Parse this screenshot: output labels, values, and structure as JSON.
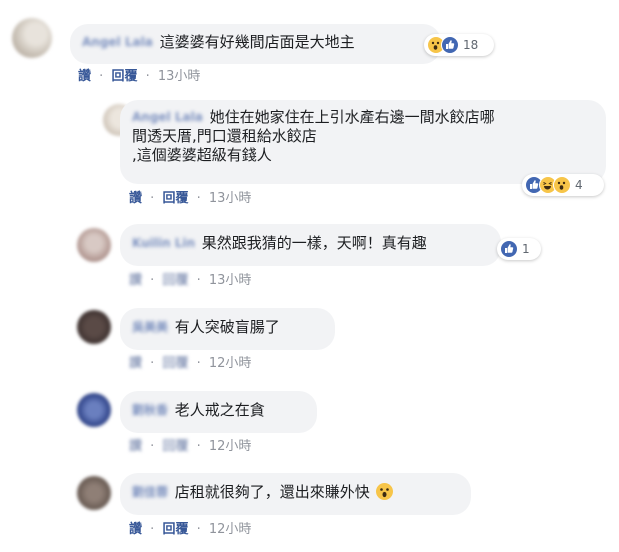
{
  "actions_labels": {
    "like": "讚",
    "reply": "回覆",
    "separator": "·"
  },
  "comments": [
    {
      "author": "Angel Lala",
      "lines": [
        "這婆婆有好幾間店面是大地主"
      ],
      "time": "13小時",
      "reaction_count": "18",
      "reactions": [
        "wow-icon",
        "like-icon"
      ]
    },
    {
      "author": "Angel Lala",
      "lines": [
        "她住在她家住在上引水產右邊一間水餃店哪",
        "間透天厝,門口還租給水餃店",
        ",這個婆婆超級有錢人"
      ],
      "time": "13小時",
      "reaction_count": "4",
      "reactions": [
        "like-icon",
        "haha-icon",
        "wow-icon"
      ]
    },
    {
      "author": "Kuilin Lin",
      "lines": [
        "果然跟我猜的一樣，天啊！真有趣"
      ],
      "time": "13小時",
      "reaction_count": "1",
      "reactions": [
        "like-icon"
      ]
    },
    {
      "author": "吳美美",
      "lines": [
        "有人突破盲腸了"
      ],
      "time": "12小時"
    },
    {
      "author": "劉秋香",
      "lines": [
        "老人戒之在貪"
      ],
      "time": "12小時"
    },
    {
      "author": "劉佳蓉",
      "lines": [
        "店租就很夠了，還出來賺外快"
      ],
      "time": "12小時",
      "inline_emoji": "wow-emoji-icon"
    }
  ],
  "colors": {
    "bubble": "#f2f3f5",
    "link": "#385898",
    "meta": "#90949c",
    "like_blue": "#4267b2",
    "reaction_yellow": "#f7c549"
  }
}
